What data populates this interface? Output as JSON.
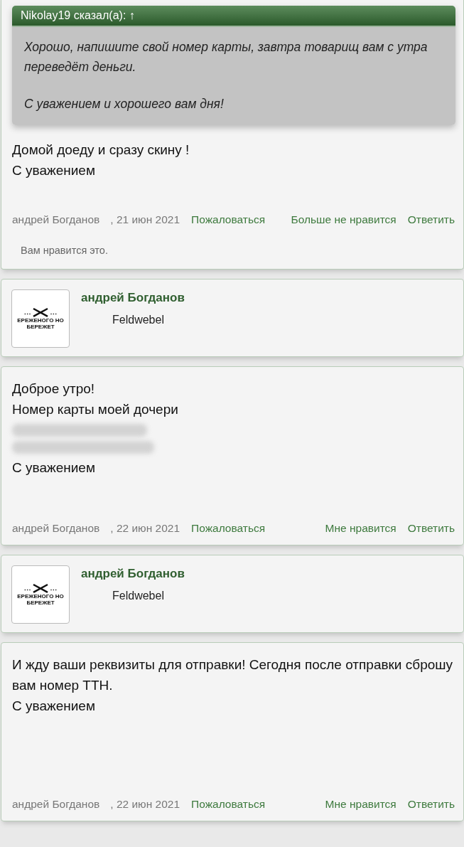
{
  "thread": [
    {
      "kind": "post",
      "quote": {
        "header": "Nikolay19 сказал(а): ↑",
        "paragraphs": [
          "Хорошо, напишите свой номер карты, завтра товарищ вам с утра переведёт деньги.",
          "С уважением и хорошего вам дня!"
        ]
      },
      "body": [
        {
          "kind": "text",
          "text": "Домой доеду и сразу скину !"
        },
        {
          "kind": "text",
          "text": "С уважением"
        }
      ],
      "author": "андрей Богданов",
      "date": ", 21 июн 2021",
      "report": "Пожаловаться",
      "like": "Больше не нравится",
      "reply": "Ответить",
      "likes_note": "Вам нравится это."
    },
    {
      "kind": "author",
      "name": "андрей Богданов",
      "rank": "Feldwebel",
      "avatar_lines": [
        "ЕРЕЖЕНОГО НО",
        "БЕРЕЖЕТ"
      ]
    },
    {
      "kind": "post",
      "body": [
        {
          "kind": "text",
          "text": "Доброе утро!"
        },
        {
          "kind": "text",
          "text": "Номер карты моей дочери"
        },
        {
          "kind": "redacted"
        },
        {
          "kind": "redacted"
        },
        {
          "kind": "text",
          "text": "С уважением"
        }
      ],
      "author": "андрей Богданов",
      "date": ", 22 июн 2021",
      "report": "Пожаловаться",
      "like": "Мне нравится",
      "reply": "Ответить"
    },
    {
      "kind": "author",
      "name": "андрей Богданов",
      "rank": "Feldwebel",
      "avatar_lines": [
        "ЕРЕЖЕНОГО НО",
        "БЕРЕЖЕТ"
      ]
    },
    {
      "kind": "post",
      "body": [
        {
          "kind": "text",
          "text": "И жду ваши реквизиты для отправки! Сегодня после отправки сброшу вам номер ТТН."
        },
        {
          "kind": "text",
          "text": "С уважением"
        }
      ],
      "author": "андрей Богданов",
      "date": ", 22 июн 2021",
      "report": "Пожаловаться",
      "like": "Мне нравится",
      "reply": "Ответить"
    }
  ]
}
